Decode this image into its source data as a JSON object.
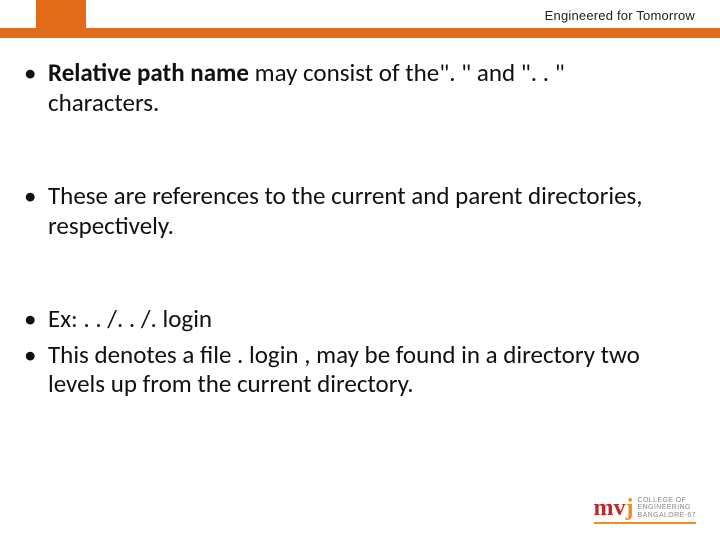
{
  "header": {
    "tagline": "Engineered for Tomorrow"
  },
  "bullets": {
    "b1_bold": "Relative path name",
    "b1_rest": " may consist of the\". \" and \". . \" characters.",
    "b2": "These are references to the current and parent directories, respectively.",
    "b3": "Ex:  . . /. . /. login",
    "b4": "This denotes a file . login , may be found in a directory two levels up from the current directory."
  },
  "logo": {
    "mark_m": "m",
    "mark_v": "v",
    "mark_j": "j",
    "line1": "COLLEGE OF",
    "line2": "ENGINEERING",
    "line3": "BANGALORE-67"
  }
}
